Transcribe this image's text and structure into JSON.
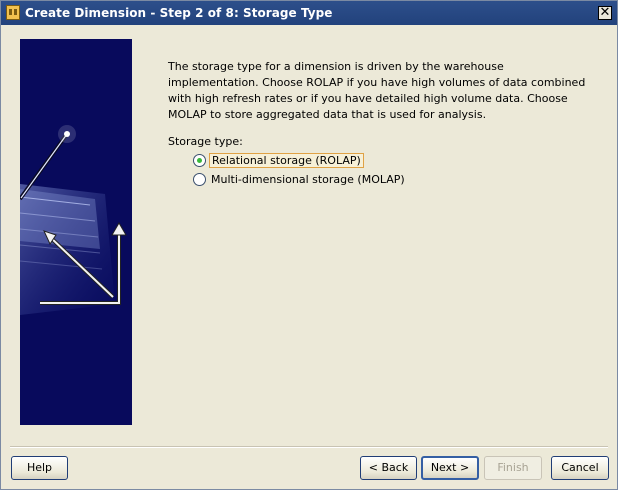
{
  "window": {
    "title": "Create Dimension - Step 2 of 8: Storage Type",
    "close_symbol": "✕",
    "app_icon": "warehouse-builder-icon"
  },
  "content": {
    "description": "The storage type for a dimension is driven by the warehouse implementation. Choose ROLAP if you have high volumes of data combined with high refresh rates or if you have detailed high volume data. Choose MOLAP to store aggregated data that is used for analysis.",
    "storage_label": "Storage type:",
    "options": [
      {
        "label": "Relational storage (ROLAP)",
        "selected": true
      },
      {
        "label": "Multi-dimensional storage (MOLAP)",
        "selected": false
      }
    ]
  },
  "buttons": {
    "help": "Help",
    "back": "< Back",
    "next": "Next >",
    "finish": "Finish",
    "cancel": "Cancel"
  },
  "colors": {
    "title_bar": "#22427c",
    "panel": "#ece9d8",
    "selected_radio": "#39b83b"
  }
}
